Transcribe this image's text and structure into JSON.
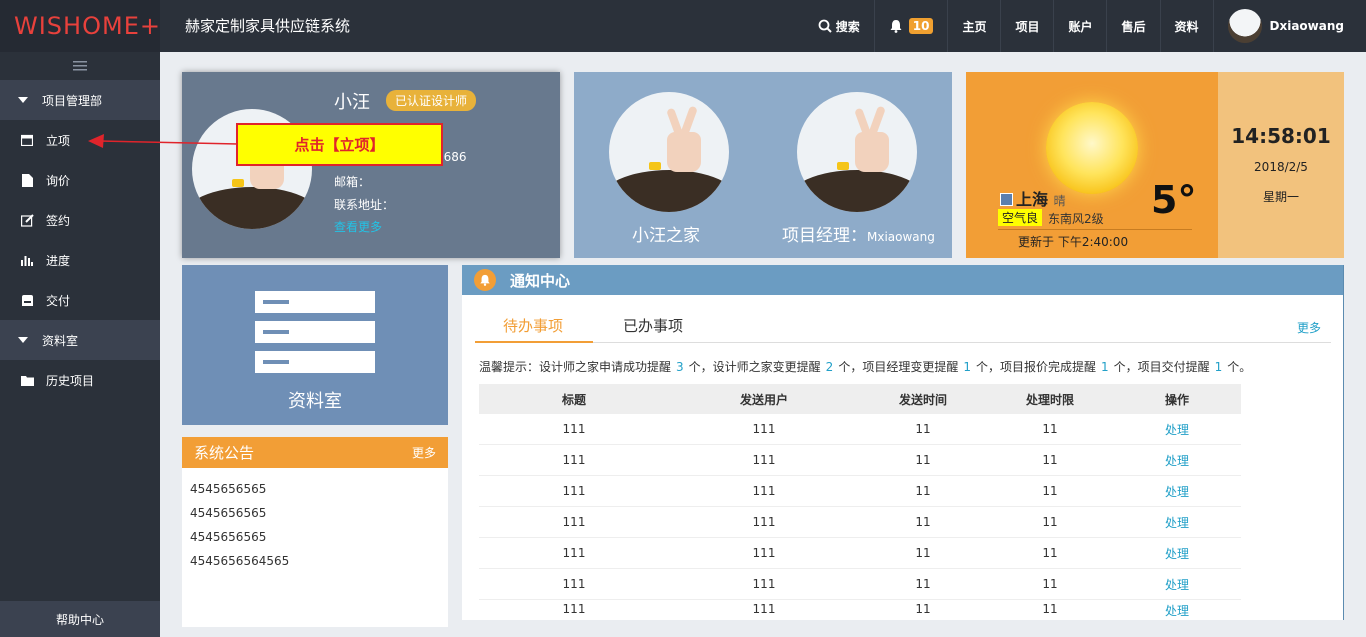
{
  "header": {
    "brand": "WISHOME+",
    "system_title": "赫家定制家具供应链系统",
    "search_label": "搜索",
    "notification_count": "10",
    "nav": [
      "主页",
      "项目",
      "账户",
      "售后",
      "资料"
    ],
    "username": "Dxiaowang"
  },
  "sidebar": {
    "groups": [
      {
        "label": "项目管理部",
        "items": [
          "立项",
          "询价",
          "签约",
          "进度",
          "交付"
        ]
      },
      {
        "label": "资料室",
        "items": [
          "历史项目"
        ]
      }
    ],
    "help": "帮助中心"
  },
  "profile": {
    "name": "小汪",
    "badge": "已认证设计师",
    "phone_tail": "5686",
    "email_label": "邮箱：",
    "address_label": "联系地址：",
    "more_link": "查看更多"
  },
  "callout": {
    "text": "点击【立项】"
  },
  "home_card": {
    "home_label": "小汪之家",
    "manager_label": "项目经理：",
    "manager_name": "Mxiaowang"
  },
  "weather": {
    "city": "上海",
    "condition": "晴",
    "temperature": "5°",
    "air_quality": "空气良",
    "wind": "东南风2级",
    "updated": "更新于 下午2:40:00"
  },
  "clock": {
    "time": "14:58:01",
    "date": "2018/2/5",
    "weekday": "星期一"
  },
  "archive": {
    "title": "资料室"
  },
  "announcements": {
    "title": "系统公告",
    "more": "更多",
    "items": [
      "4545656565",
      "4545656565",
      "4545656565",
      "4545656564565"
    ]
  },
  "notification_center": {
    "title": "通知中心",
    "tabs": [
      "待办事项",
      "已办事项"
    ],
    "more": "更多",
    "tip": {
      "prefix": "温馨提示：设计师之家申请成功提醒",
      "n1": "3",
      "s1": "个，设计师之家变更提醒",
      "n2": "2",
      "s2": "个，项目经理变更提醒",
      "n3": "1",
      "s3": "个，项目报价完成提醒",
      "n4": "1",
      "s4": "个，项目交付提醒",
      "n5": "1",
      "s5": "个。"
    },
    "columns": [
      "标题",
      "发送用户",
      "发送时间",
      "处理时限",
      "操作"
    ],
    "rows": [
      [
        "111",
        "111",
        "11",
        "11",
        "处理"
      ],
      [
        "111",
        "111",
        "11",
        "11",
        "处理"
      ],
      [
        "111",
        "111",
        "11",
        "11",
        "处理"
      ],
      [
        "111",
        "111",
        "11",
        "11",
        "处理"
      ],
      [
        "111",
        "111",
        "11",
        "11",
        "处理"
      ],
      [
        "111",
        "111",
        "11",
        "11",
        "处理"
      ],
      [
        "111",
        "111",
        "11",
        "11",
        "处理"
      ]
    ]
  }
}
